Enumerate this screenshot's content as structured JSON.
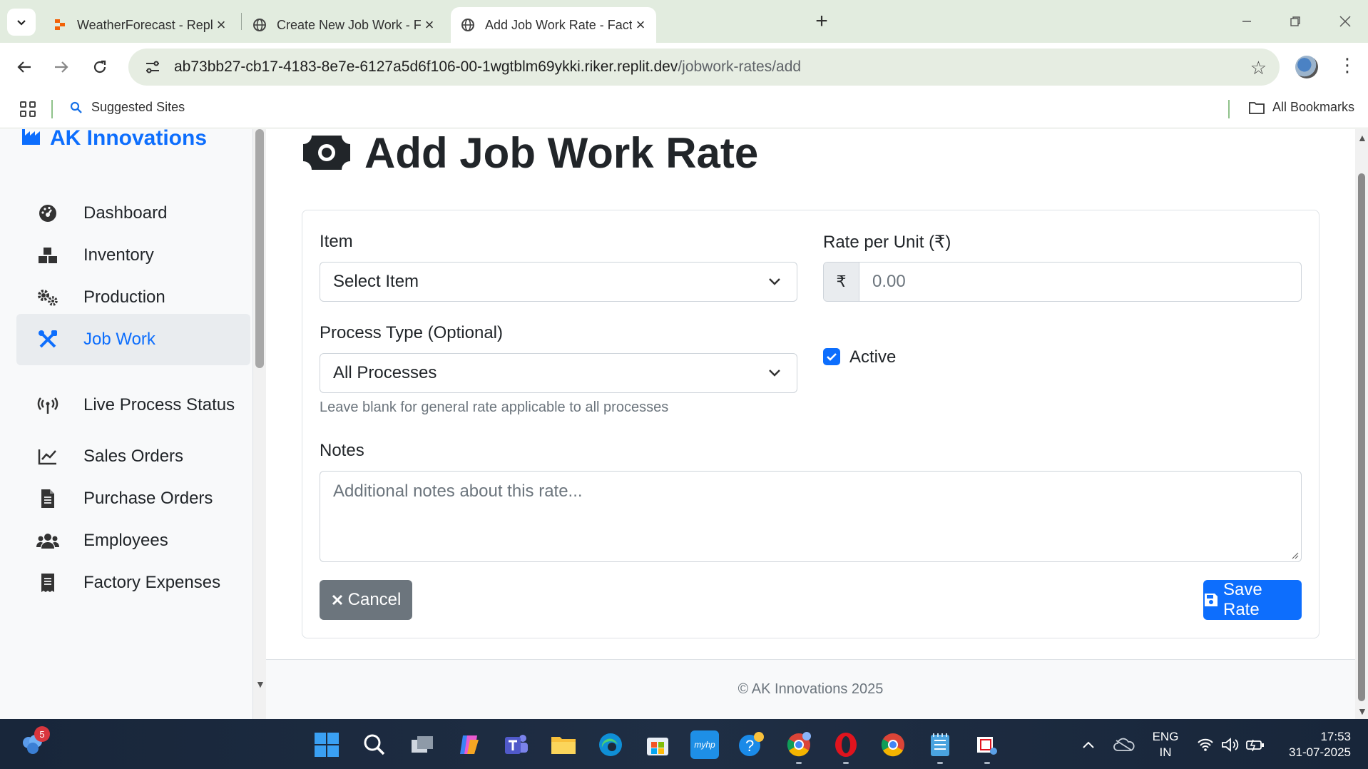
{
  "browser": {
    "tabs": [
      {
        "title": "WeatherForecast - Replit",
        "active": false
      },
      {
        "title": "Create New Job Work - Factory",
        "active": false
      },
      {
        "title": "Add Job Work Rate - Factory M",
        "active": true
      }
    ],
    "url_host": "ab73bb27-cb17-4183-8e7e-6127a5d6f106-00-1wgtblm69ykki.riker.replit.dev",
    "url_path": "/jobwork-rates/add",
    "bookmarks": {
      "suggested": "Suggested Sites",
      "all": "All Bookmarks"
    }
  },
  "sidebar": {
    "brand": "AK Innovations",
    "items": [
      {
        "label": "Dashboard",
        "icon": "gauge-icon",
        "active": false
      },
      {
        "label": "Inventory",
        "icon": "boxes-icon",
        "active": false
      },
      {
        "label": "Production",
        "icon": "gears-icon",
        "active": false
      },
      {
        "label": "Job Work",
        "icon": "tools-icon",
        "active": true
      },
      {
        "label": "Live Process Status",
        "icon": "broadcast-icon",
        "active": false
      },
      {
        "label": "Sales Orders",
        "icon": "chart-line-icon",
        "active": false
      },
      {
        "label": "Purchase Orders",
        "icon": "document-icon",
        "active": false
      },
      {
        "label": "Employees",
        "icon": "users-icon",
        "active": false
      },
      {
        "label": "Factory Expenses",
        "icon": "receipt-icon",
        "active": false
      }
    ]
  },
  "form": {
    "title": "Add Job Work Rate",
    "item_label": "Item",
    "item_value": "Select Item",
    "rate_label": "Rate per Unit (₹)",
    "rate_prefix": "₹",
    "rate_placeholder": "0.00",
    "process_label": "Process Type (Optional)",
    "process_value": "All Processes",
    "process_help": "Leave blank for general rate applicable to all processes",
    "active_label": "Active",
    "active_checked": true,
    "notes_label": "Notes",
    "notes_placeholder": "Additional notes about this rate...",
    "cancel_label": "Cancel",
    "save_label": "Save Rate"
  },
  "footer": {
    "text": "© AK Innovations 2025"
  },
  "taskbar": {
    "notification_count": "5",
    "lang_line1": "ENG",
    "lang_line2": "IN",
    "time": "17:53",
    "date": "31-07-2025"
  },
  "colors": {
    "primary": "#0d6efd",
    "secondary": "#6c757d"
  }
}
